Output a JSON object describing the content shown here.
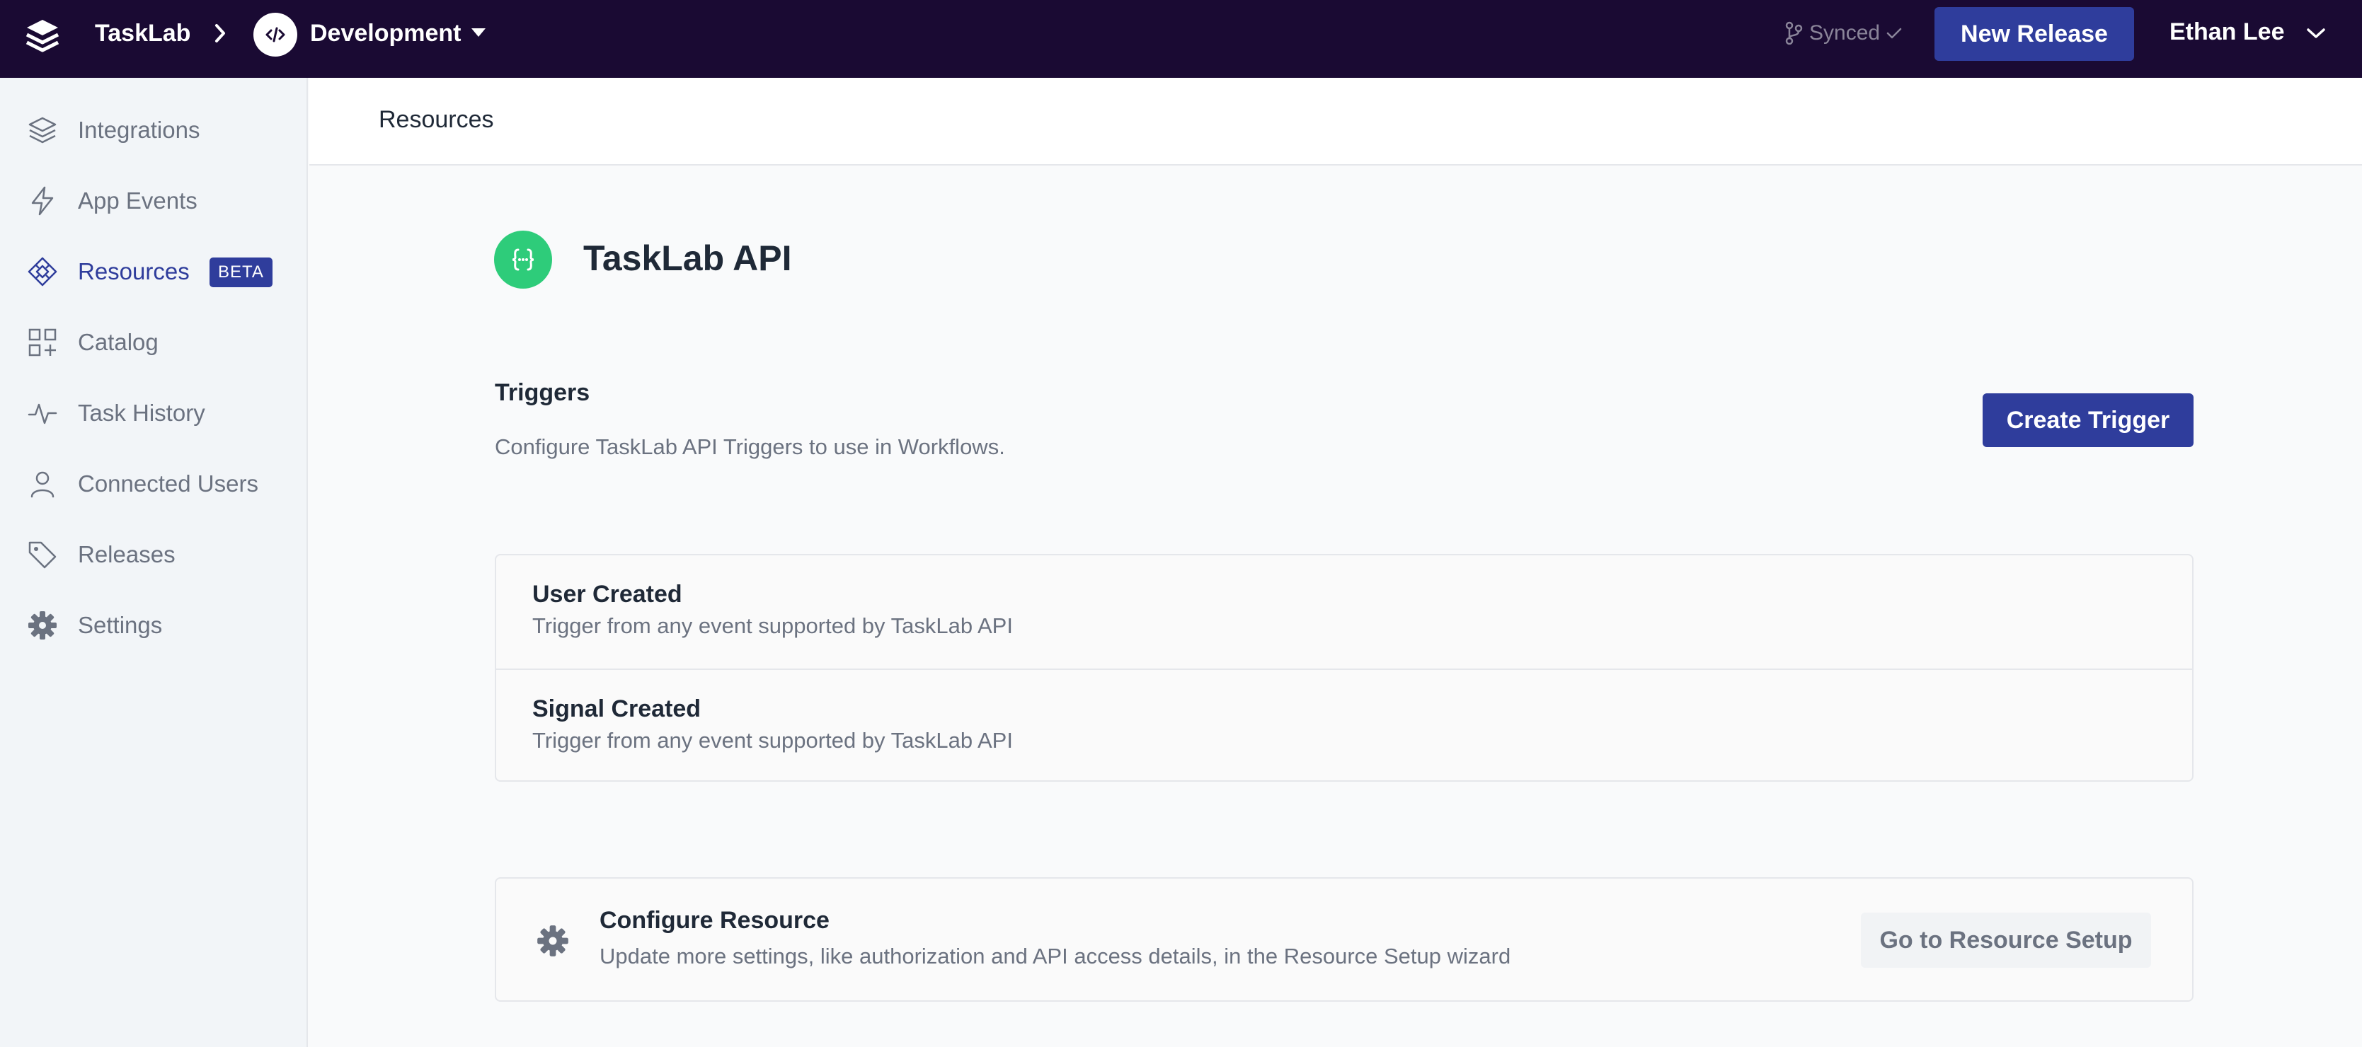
{
  "topbar": {
    "app_name": "TaskLab",
    "environment": "Development",
    "sync_status": "Synced",
    "new_release_label": "New Release",
    "user_name": "Ethan Lee"
  },
  "sidebar": {
    "items": [
      {
        "label": "Integrations",
        "icon": "layers-icon"
      },
      {
        "label": "App Events",
        "icon": "lightning-icon"
      },
      {
        "label": "Resources",
        "icon": "diamond-nodes-icon",
        "badge": "BETA",
        "active": true
      },
      {
        "label": "Catalog",
        "icon": "grid-plus-icon"
      },
      {
        "label": "Task History",
        "icon": "activity-icon"
      },
      {
        "label": "Connected Users",
        "icon": "user-icon"
      },
      {
        "label": "Releases",
        "icon": "tag-icon"
      },
      {
        "label": "Settings",
        "icon": "gear-icon"
      }
    ]
  },
  "header": {
    "title": "Resources"
  },
  "resource": {
    "title": "TaskLab API",
    "icon": "code-braces-icon",
    "icon_color": "#2ecc7a"
  },
  "triggers": {
    "title": "Triggers",
    "description": "Configure TaskLab API Triggers to use in Workflows.",
    "create_label": "Create Trigger",
    "items": [
      {
        "name": "User Created",
        "description": "Trigger from any event supported by TaskLab API"
      },
      {
        "name": "Signal Created",
        "description": "Trigger from any event supported by TaskLab API"
      }
    ]
  },
  "configure": {
    "title": "Configure Resource",
    "description": "Update more settings, like authorization and API access details, in the Resource Setup wizard",
    "button_label": "Go to Resource Setup"
  },
  "colors": {
    "topbar_bg": "#1a0a33",
    "accent": "#2f3d9c",
    "resource_green": "#2ecc7a"
  }
}
